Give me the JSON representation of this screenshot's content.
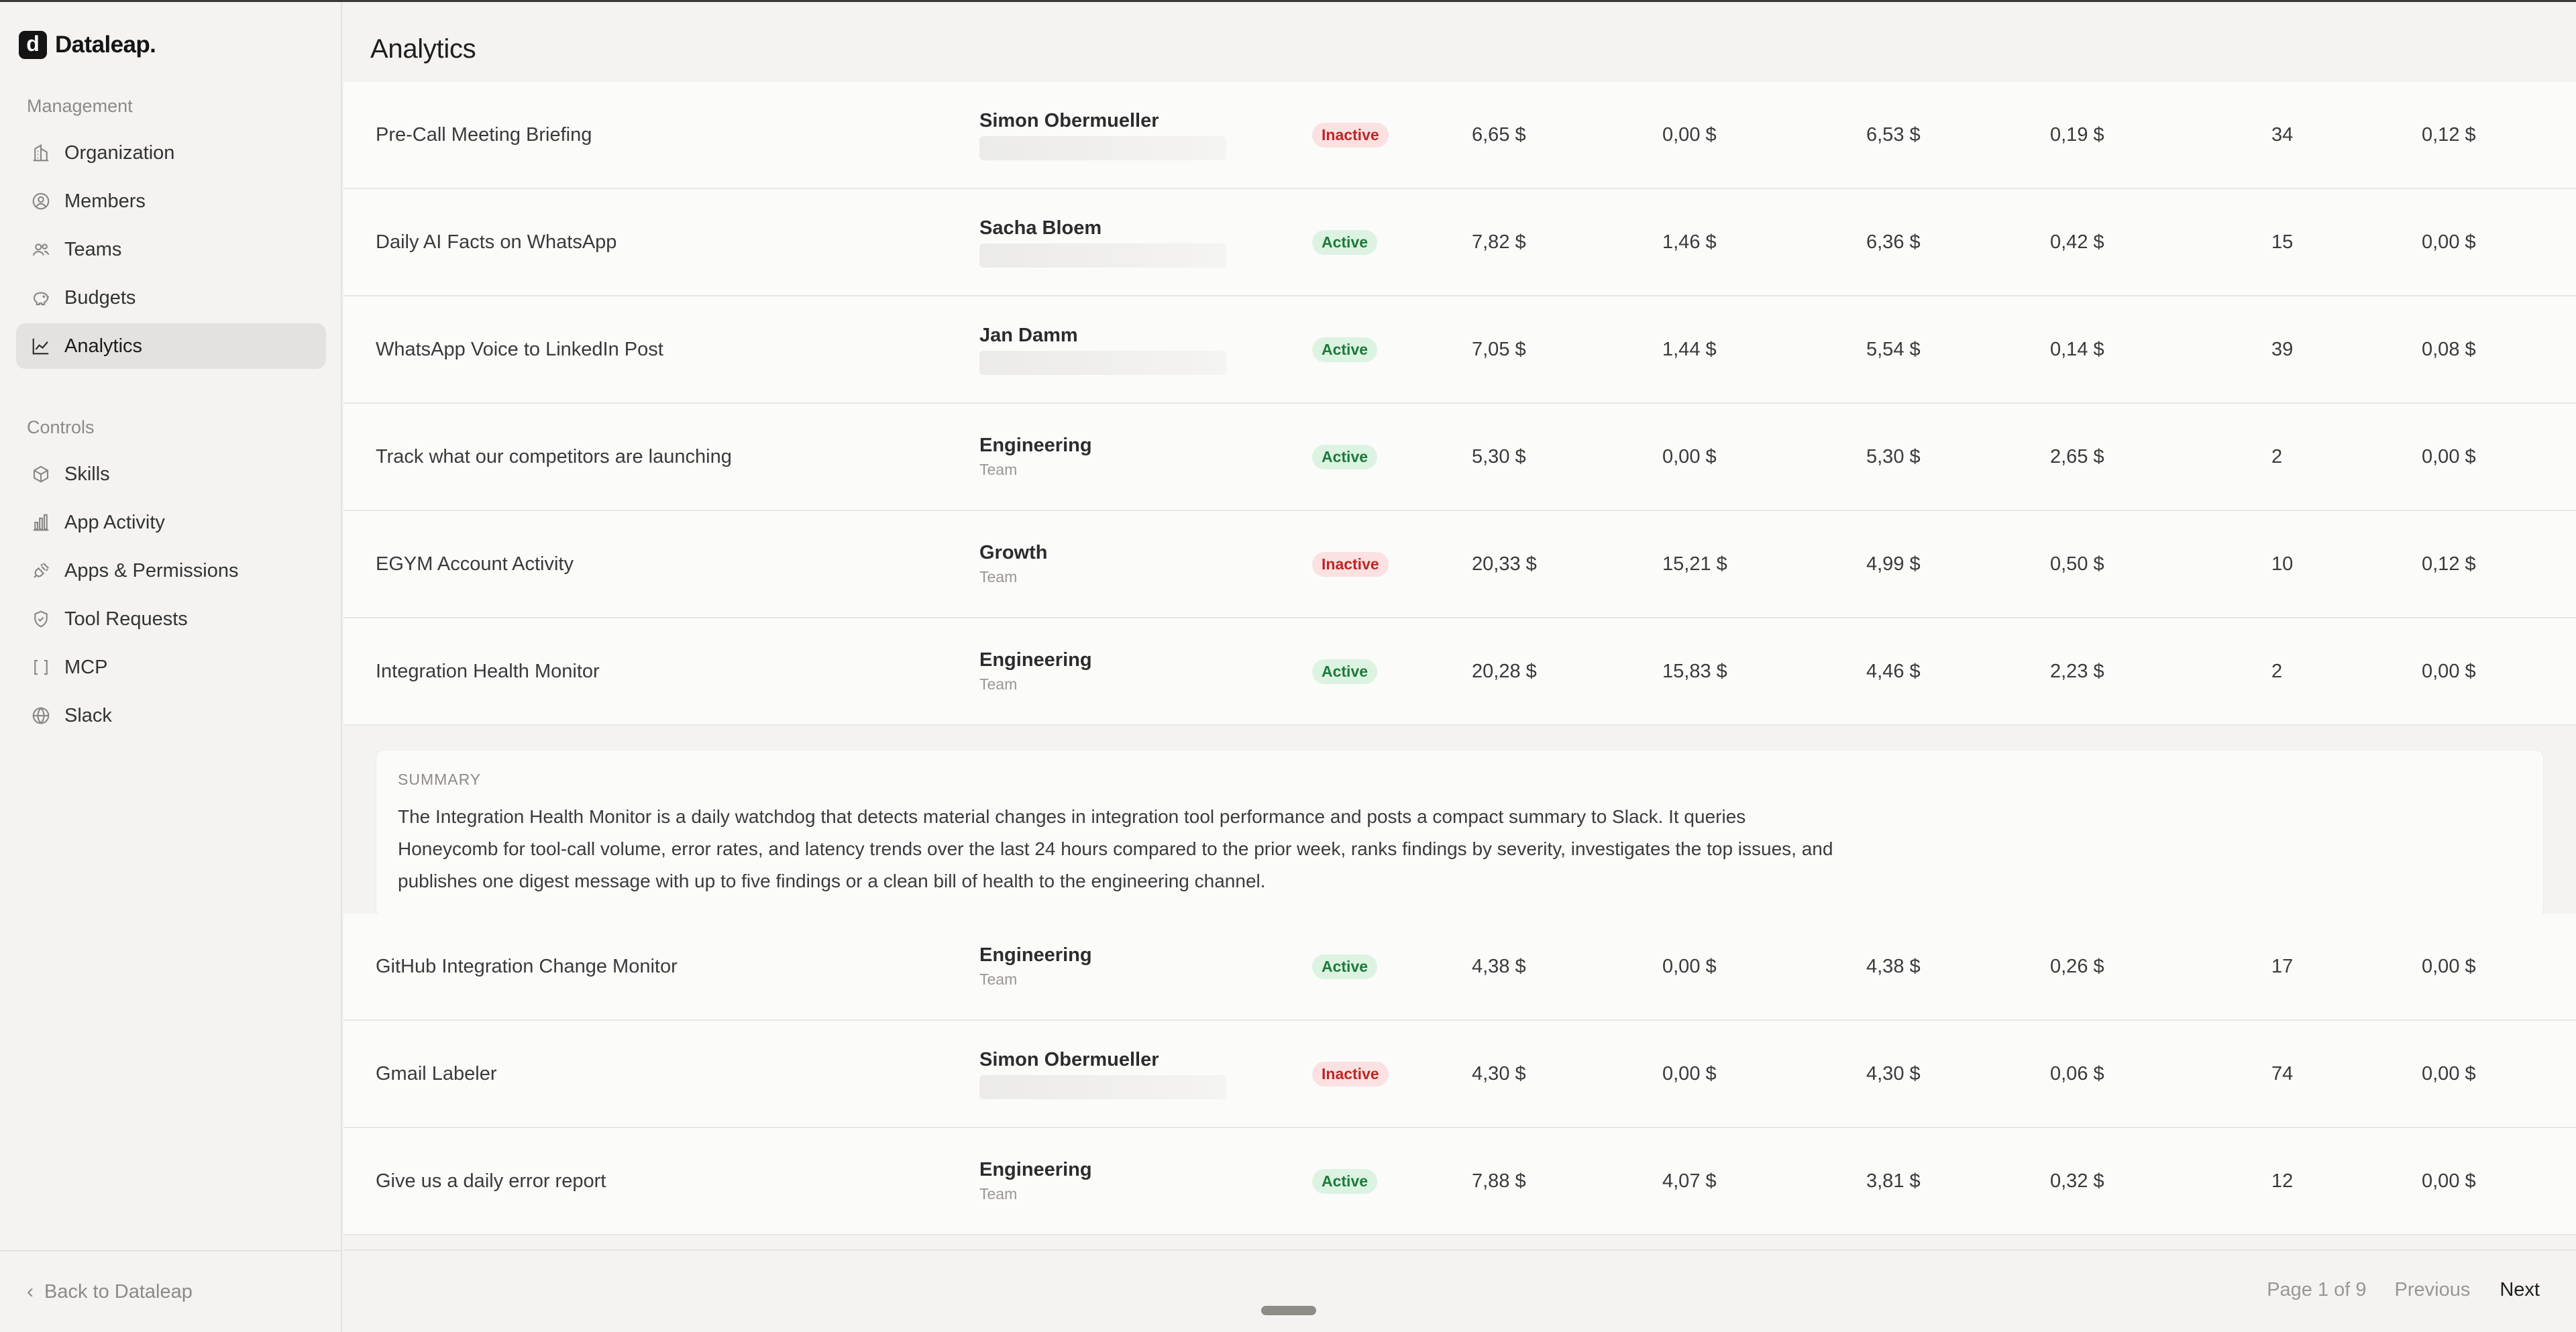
{
  "brand": {
    "logo_letter": "d",
    "name": "Dataleap."
  },
  "sidebar": {
    "management_heading": "Management",
    "management_items": [
      {
        "label": "Organization",
        "icon": "building-icon"
      },
      {
        "label": "Members",
        "icon": "user-circle-icon"
      },
      {
        "label": "Teams",
        "icon": "users-icon"
      },
      {
        "label": "Budgets",
        "icon": "piggy-bank-icon"
      },
      {
        "label": "Analytics",
        "icon": "chart-line-icon",
        "active": true
      }
    ],
    "controls_heading": "Controls",
    "controls_items": [
      {
        "label": "Skills",
        "icon": "box-icon"
      },
      {
        "label": "App Activity",
        "icon": "bar-chart-icon"
      },
      {
        "label": "Apps & Permissions",
        "icon": "plug-icon"
      },
      {
        "label": "Tool Requests",
        "icon": "shield-check-icon"
      },
      {
        "label": "MCP",
        "icon": "brackets-icon"
      },
      {
        "label": "Slack",
        "icon": "globe-icon"
      }
    ],
    "back_label": "Back to Dataleap"
  },
  "header": {
    "title": "Analytics"
  },
  "rows": [
    {
      "name": "Pre-Call Meeting Briefing",
      "owner": "Simon Obermueller",
      "owner_sub": "",
      "status": "Inactive",
      "v1": "6,65 $",
      "v2": "0,00 $",
      "v3": "6,53 $",
      "v4": "0,19 $",
      "v5": "34",
      "v6": "0,12 $"
    },
    {
      "name": "Daily AI Facts on WhatsApp",
      "owner": "Sacha Bloem",
      "owner_sub": "",
      "status": "Active",
      "v1": "7,82 $",
      "v2": "1,46 $",
      "v3": "6,36 $",
      "v4": "0,42 $",
      "v5": "15",
      "v6": "0,00 $"
    },
    {
      "name": "WhatsApp Voice to LinkedIn Post",
      "owner": "Jan Damm",
      "owner_sub": "",
      "status": "Active",
      "v1": "7,05 $",
      "v2": "1,44 $",
      "v3": "5,54 $",
      "v4": "0,14 $",
      "v5": "39",
      "v6": "0,08 $"
    },
    {
      "name": "Track what our competitors are launching",
      "owner": "Engineering",
      "owner_sub": "Team",
      "status": "Active",
      "v1": "5,30 $",
      "v2": "0,00 $",
      "v3": "5,30 $",
      "v4": "2,65 $",
      "v5": "2",
      "v6": "0,00 $"
    },
    {
      "name": "EGYM Account Activity",
      "owner": "Growth",
      "owner_sub": "Team",
      "status": "Inactive",
      "v1": "20,33 $",
      "v2": "15,21 $",
      "v3": "4,99 $",
      "v4": "0,50 $",
      "v5": "10",
      "v6": "0,12 $"
    },
    {
      "name": "Integration Health Monitor",
      "owner": "Engineering",
      "owner_sub": "Team",
      "status": "Active",
      "v1": "20,28 $",
      "v2": "15,83 $",
      "v3": "4,46 $",
      "v4": "2,23 $",
      "v5": "2",
      "v6": "0,00 $"
    },
    {
      "name": "GitHub Integration Change Monitor",
      "owner": "Engineering",
      "owner_sub": "Team",
      "status": "Active",
      "v1": "4,38 $",
      "v2": "0,00 $",
      "v3": "4,38 $",
      "v4": "0,26 $",
      "v5": "17",
      "v6": "0,00 $"
    },
    {
      "name": "Gmail Labeler",
      "owner": "Simon Obermueller",
      "owner_sub": "",
      "status": "Inactive",
      "v1": "4,30 $",
      "v2": "0,00 $",
      "v3": "4,30 $",
      "v4": "0,06 $",
      "v5": "74",
      "v6": "0,00 $"
    },
    {
      "name": "Give us a daily error report",
      "owner": "Engineering",
      "owner_sub": "Team",
      "status": "Active",
      "v1": "7,88 $",
      "v2": "4,07 $",
      "v3": "3,81 $",
      "v4": "0,32 $",
      "v5": "12",
      "v6": "0,00 $"
    }
  ],
  "summary": {
    "label": "SUMMARY",
    "text": "The Integration Health Monitor is a daily watchdog that detects material changes in integration tool performance and posts a compact summary to Slack. It queries Honeycomb for tool-call volume, error rates, and latency trends over the last 24 hours compared to the prior week, ranks findings by severity, investigates the top issues, and publishes one digest message with up to five findings or a clean bill of health to the engineering channel."
  },
  "pagination": {
    "info": "Page 1 of 9",
    "previous": "Previous",
    "next": "Next"
  },
  "colors": {
    "active_bg": "#dcf3e2",
    "active_fg": "#1d7a3a",
    "inactive_bg": "#fbe1e1",
    "inactive_fg": "#c02525"
  }
}
